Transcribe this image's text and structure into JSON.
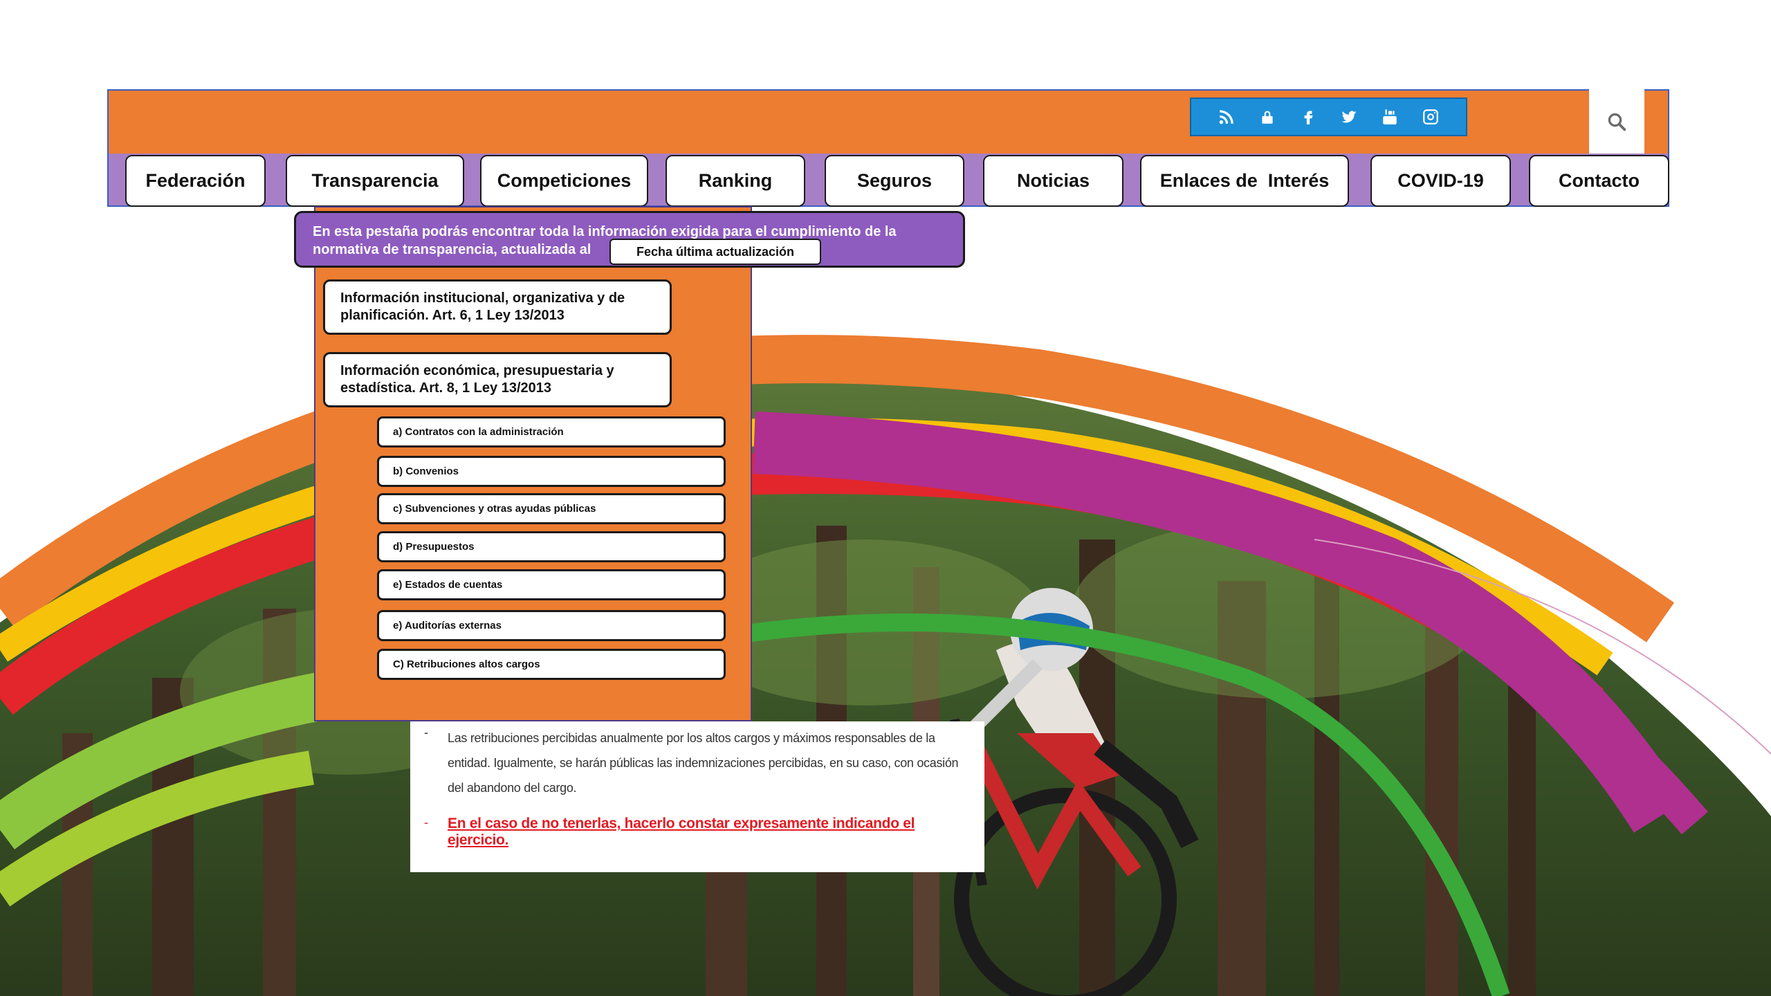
{
  "header": {
    "brand_color": "#ec7d31",
    "nav_color": "#a77fc6",
    "social_icons": [
      "rss-icon",
      "lock-icon",
      "facebook-icon",
      "twitter-icon",
      "youtube-icon",
      "instagram-icon"
    ],
    "search_icon": "search-icon"
  },
  "nav": {
    "items": [
      {
        "label": "Federación"
      },
      {
        "label": "Transparencia"
      },
      {
        "label": "Competiciones"
      },
      {
        "label": "Ranking"
      },
      {
        "label": "Seguros"
      },
      {
        "label": "Noticias"
      },
      {
        "label": "Enlaces de  Interés"
      },
      {
        "label": "COVID-19"
      },
      {
        "label": "Contacto"
      }
    ]
  },
  "transparencia": {
    "notice_line1": "En esta pestaña podrás encontrar toda la información exigida para el cumplimiento de la",
    "notice_line2": "normativa de transparencia, actualizada al",
    "date_label": "Fecha última actualización",
    "sections": [
      {
        "line1": "Información  institucional, organizativa y de",
        "line2": "planificación. Art. 6, 1 Ley 13/2013"
      },
      {
        "line1": "Información económica, presupuestaria y",
        "line2": "estadística. Art. 8, 1 Ley 13/2013"
      }
    ],
    "sub_items": [
      "a) Contratos con la administración",
      "b) Convenios",
      "c) Subvenciones y otras ayudas públicas",
      "d) Presupuestos",
      "e) Estados de cuentas",
      "e) Auditorías externas",
      "C) Retribuciones altos cargos"
    ]
  },
  "info": {
    "dash": "-",
    "paragraph": "Las retribuciones percibidas anualmente por los altos cargos y máximos responsables de la entidad. Igualmente, se harán públicas las indemnizaciones percibidas, en su caso, con ocasión del abandono del cargo.",
    "warning": "En el caso de no tenerlas, hacerlo constar expresamente indicando el ejercicio.",
    "warning_color": "#e31b23"
  }
}
